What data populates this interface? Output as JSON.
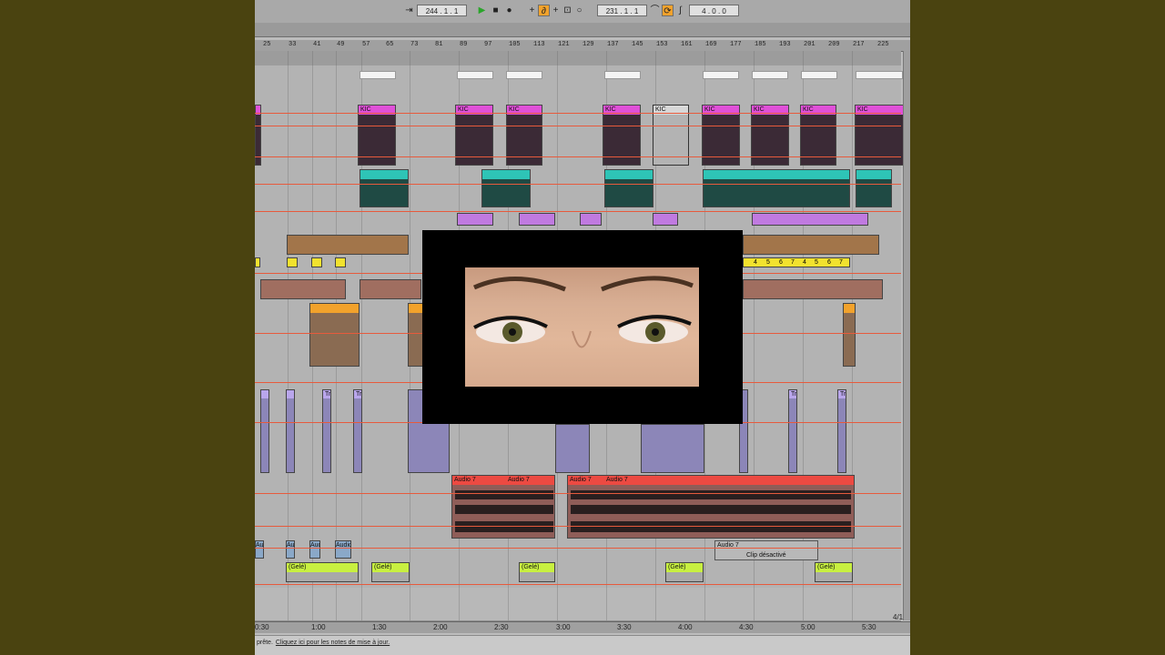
{
  "transport": {
    "position_left": "244 .  1 .  1",
    "position_right": "231 .  1 .  1",
    "loop_length": "4 .  0 .  0",
    "icons": [
      "arrow-icon",
      "play-icon",
      "stop-icon",
      "record-icon",
      "add-icon",
      "draw-icon",
      "plus-icon",
      "loop-icon",
      "metronome-icon",
      "punch-icon",
      "loop-switch-icon",
      "curve-icon"
    ]
  },
  "ruler": {
    "bars": [
      "25",
      "33",
      "41",
      "49",
      "57",
      "65",
      "73",
      "81",
      "89",
      "97",
      "105",
      "113",
      "121",
      "129",
      "137",
      "145",
      "153",
      "161",
      "169",
      "177",
      "185",
      "193",
      "201",
      "209",
      "217",
      "225"
    ]
  },
  "timeline": {
    "times": [
      "0:30",
      "1:00",
      "1:30",
      "2:00",
      "2:30",
      "3:00",
      "3:30",
      "4:00",
      "4:30",
      "5:00",
      "5:30"
    ]
  },
  "clips": {
    "kick_label": "KIC",
    "audio7_label": "Audio 7",
    "audio_label": "Audio",
    "tr_label": "Tr",
    "frozen_label": "(Gelé)",
    "disabled_label": "Clip désactivé",
    "yellow_numbers": [
      "4",
      "5",
      "6",
      "7",
      "4",
      "5",
      "6",
      "7"
    ]
  },
  "status": {
    "text": "prête.",
    "link": "Cliquez ici pour les notes de mise à jour."
  },
  "scroll_label": "4/1",
  "colors": {
    "kick": "#e050d8",
    "teal": "#2ec4b6",
    "purple": "#c07ae0",
    "yellow": "#f2e22e",
    "orange": "#f2a22c",
    "audio_red": "#ec4a42",
    "frozen": "#c8f040",
    "automation": "#e75a3c"
  }
}
